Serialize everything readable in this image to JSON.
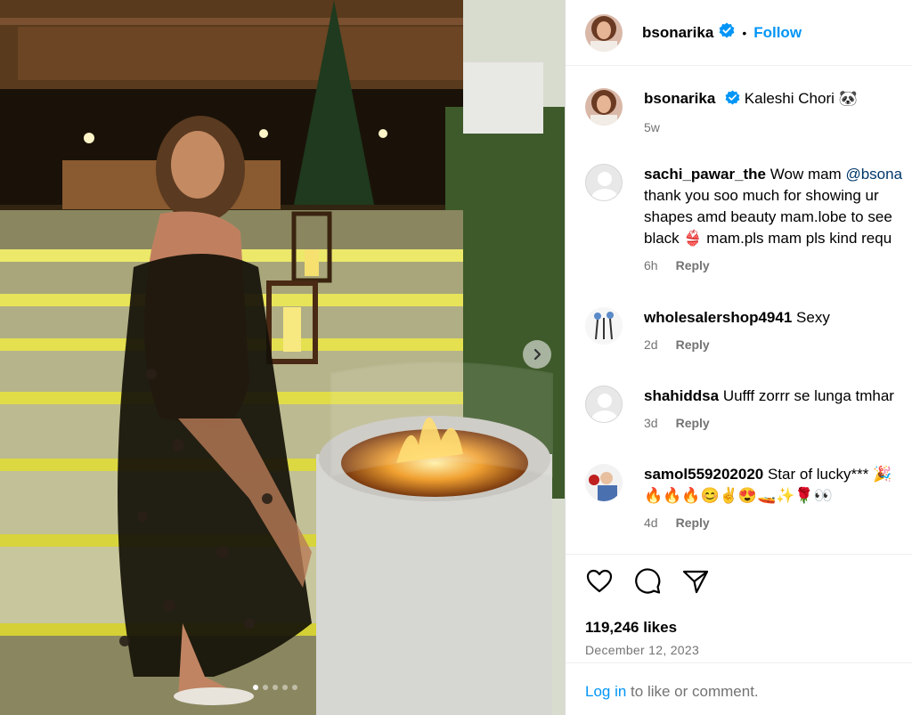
{
  "post": {
    "username": "bsonarika",
    "follow_label": "Follow",
    "separator": "•",
    "caption": "Kaleshi Chori 🐼",
    "caption_age": "5w",
    "likes": "119,246 likes",
    "date": "December 12, 2023",
    "login_link": "Log in",
    "login_rest": " to like or comment.",
    "carousel_count": 5,
    "carousel_active": 0
  },
  "comments": [
    {
      "username": "sachi_pawar_the",
      "lines": [
        "Wow mam ",
        "thank you soo much for showing ur",
        "shapes amd beauty mam.lobe to see",
        "black 👙 mam.pls mam pls kind requ"
      ],
      "mention": "@bsona",
      "age": "6h",
      "reply": "Reply"
    },
    {
      "username": "wholesalershop4941",
      "text": "Sexy",
      "age": "2d",
      "reply": "Reply"
    },
    {
      "username": "shahiddsa",
      "text": "Uufff zorrr se lunga tmhar",
      "age": "3d",
      "reply": "Reply"
    },
    {
      "username": "samol559202020",
      "text": "Star of lucky*** 🎉",
      "emoji_line": "🔥🔥🔥😊✌️😍🚤✨🌹👀",
      "age": "4d",
      "reply": "Reply"
    }
  ],
  "colors": {
    "link_blue": "#0095f6",
    "verified_blue": "#0095f6",
    "muted": "#737373",
    "mention": "#00376b"
  },
  "icons": [
    "verified-icon",
    "heart-icon",
    "comment-icon",
    "share-icon",
    "chevron-right-icon"
  ]
}
